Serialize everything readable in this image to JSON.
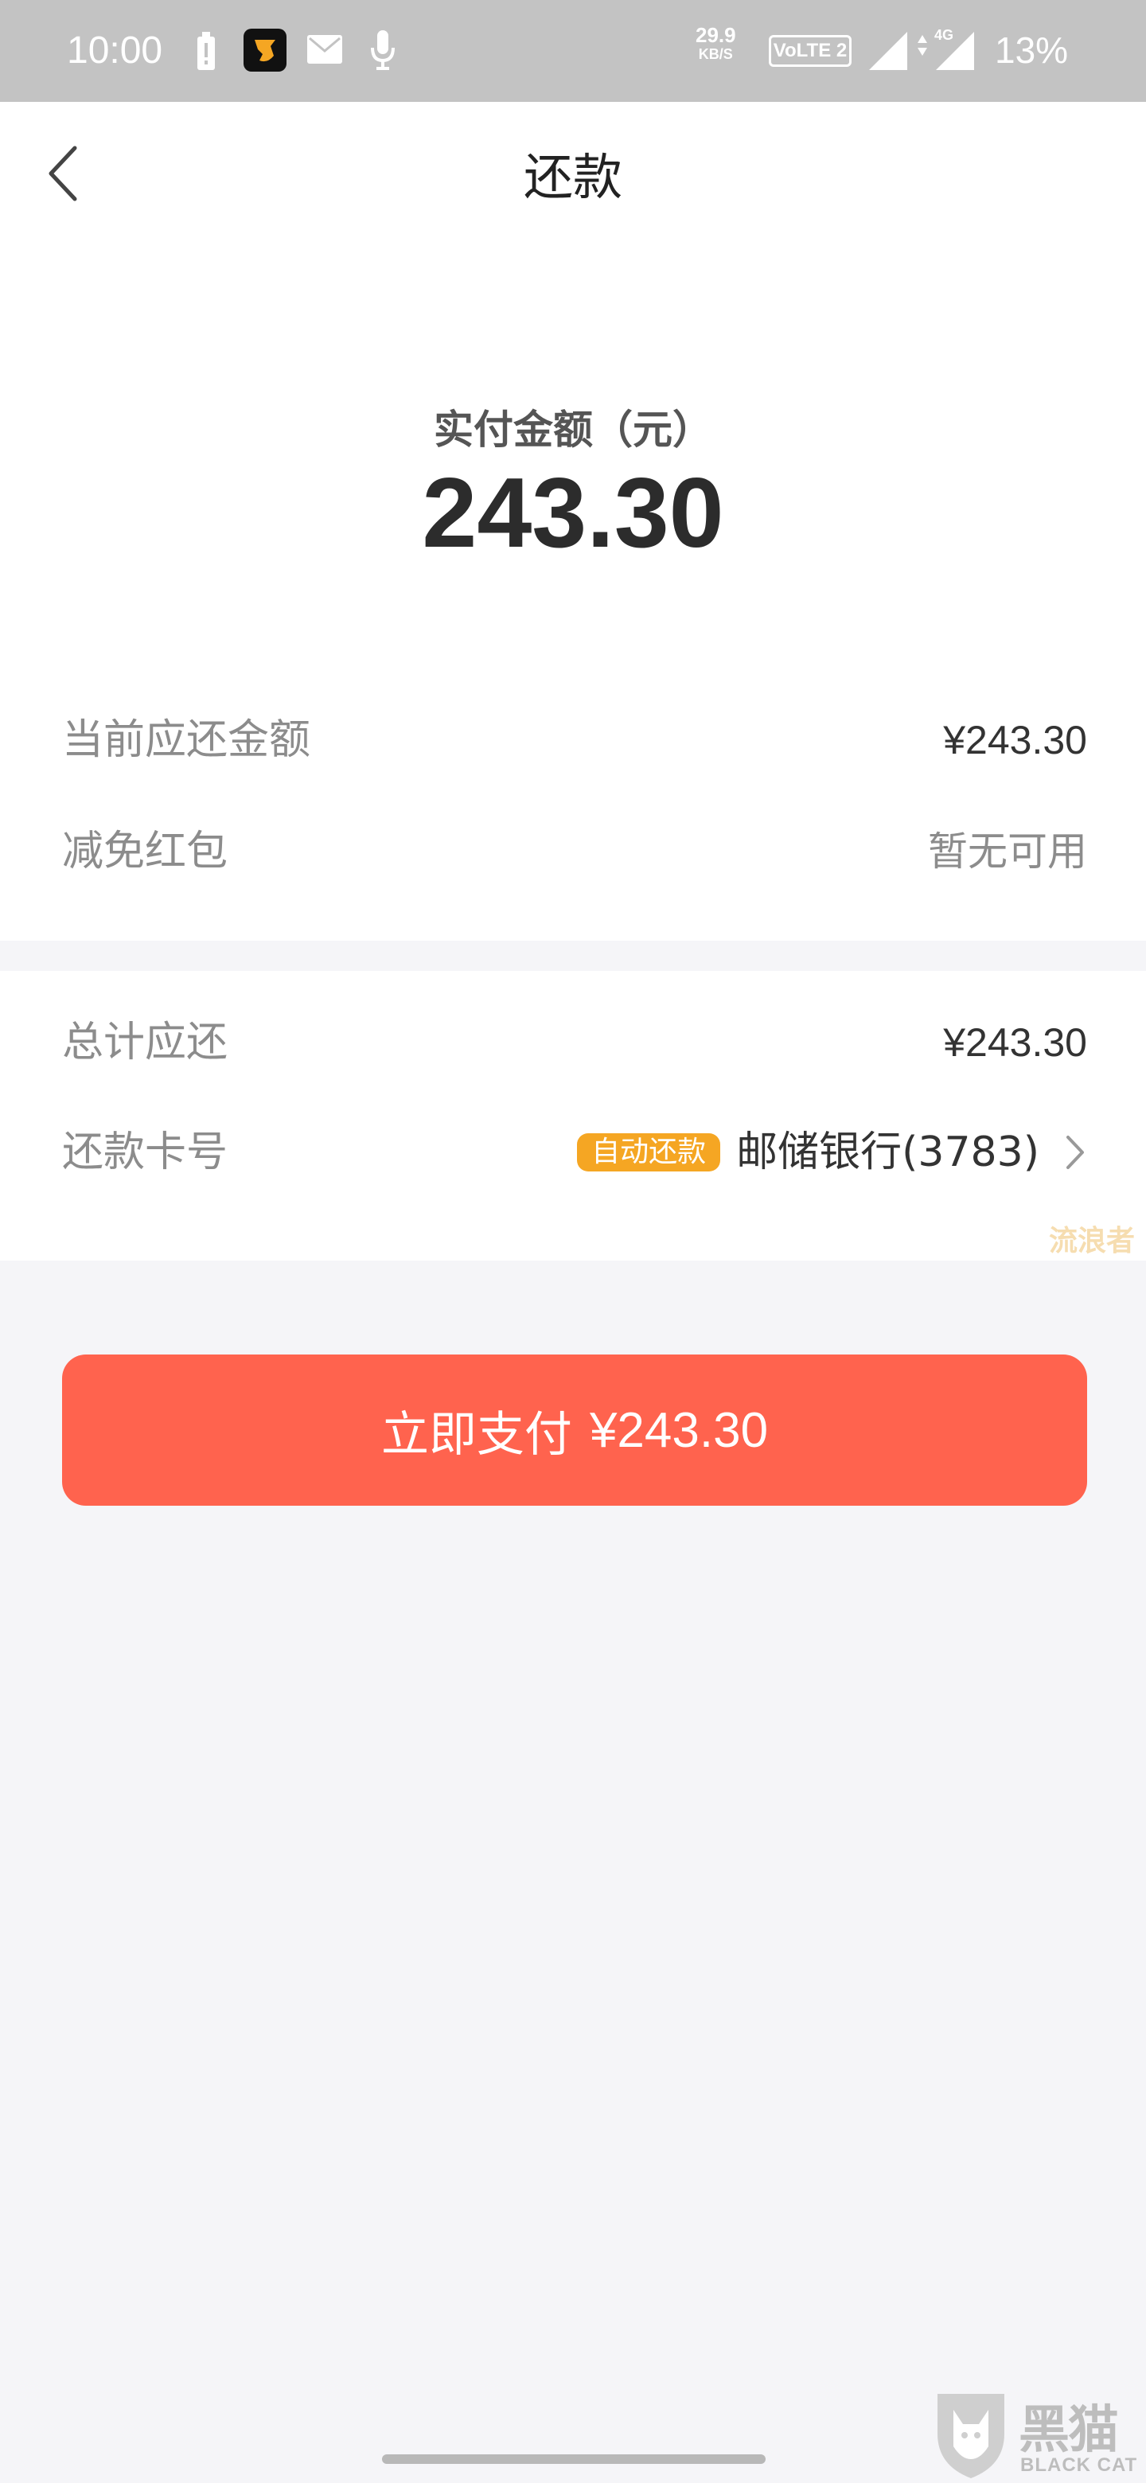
{
  "status_bar": {
    "time": "10:00",
    "speed_value": "29.9",
    "speed_unit": "KB/S",
    "volte_label": "VoLTE 2",
    "network_label": "4G",
    "battery": "13%"
  },
  "header": {
    "title": "还款"
  },
  "payment": {
    "label": "实付金额（元）",
    "amount": "243.30"
  },
  "details": {
    "current_due_label": "当前应还金额",
    "current_due_value": "¥243.30",
    "discount_label": "减免红包",
    "discount_value": "暂无可用"
  },
  "summary": {
    "total_label": "总计应还",
    "total_value": "¥243.30",
    "card_label": "还款卡号",
    "auto_badge": "自动还款",
    "bank_card": "邮储银行(3783)"
  },
  "watermark_text": "流浪者",
  "pay_button": {
    "label": "立即支付",
    "amount": "¥243.30"
  },
  "brand": {
    "name_cn": "黑猫",
    "name_en": "BLACK CAT"
  },
  "colors": {
    "accent": "#ff634e",
    "badge": "#f5a623",
    "status_bar": "#c3c3c3"
  }
}
